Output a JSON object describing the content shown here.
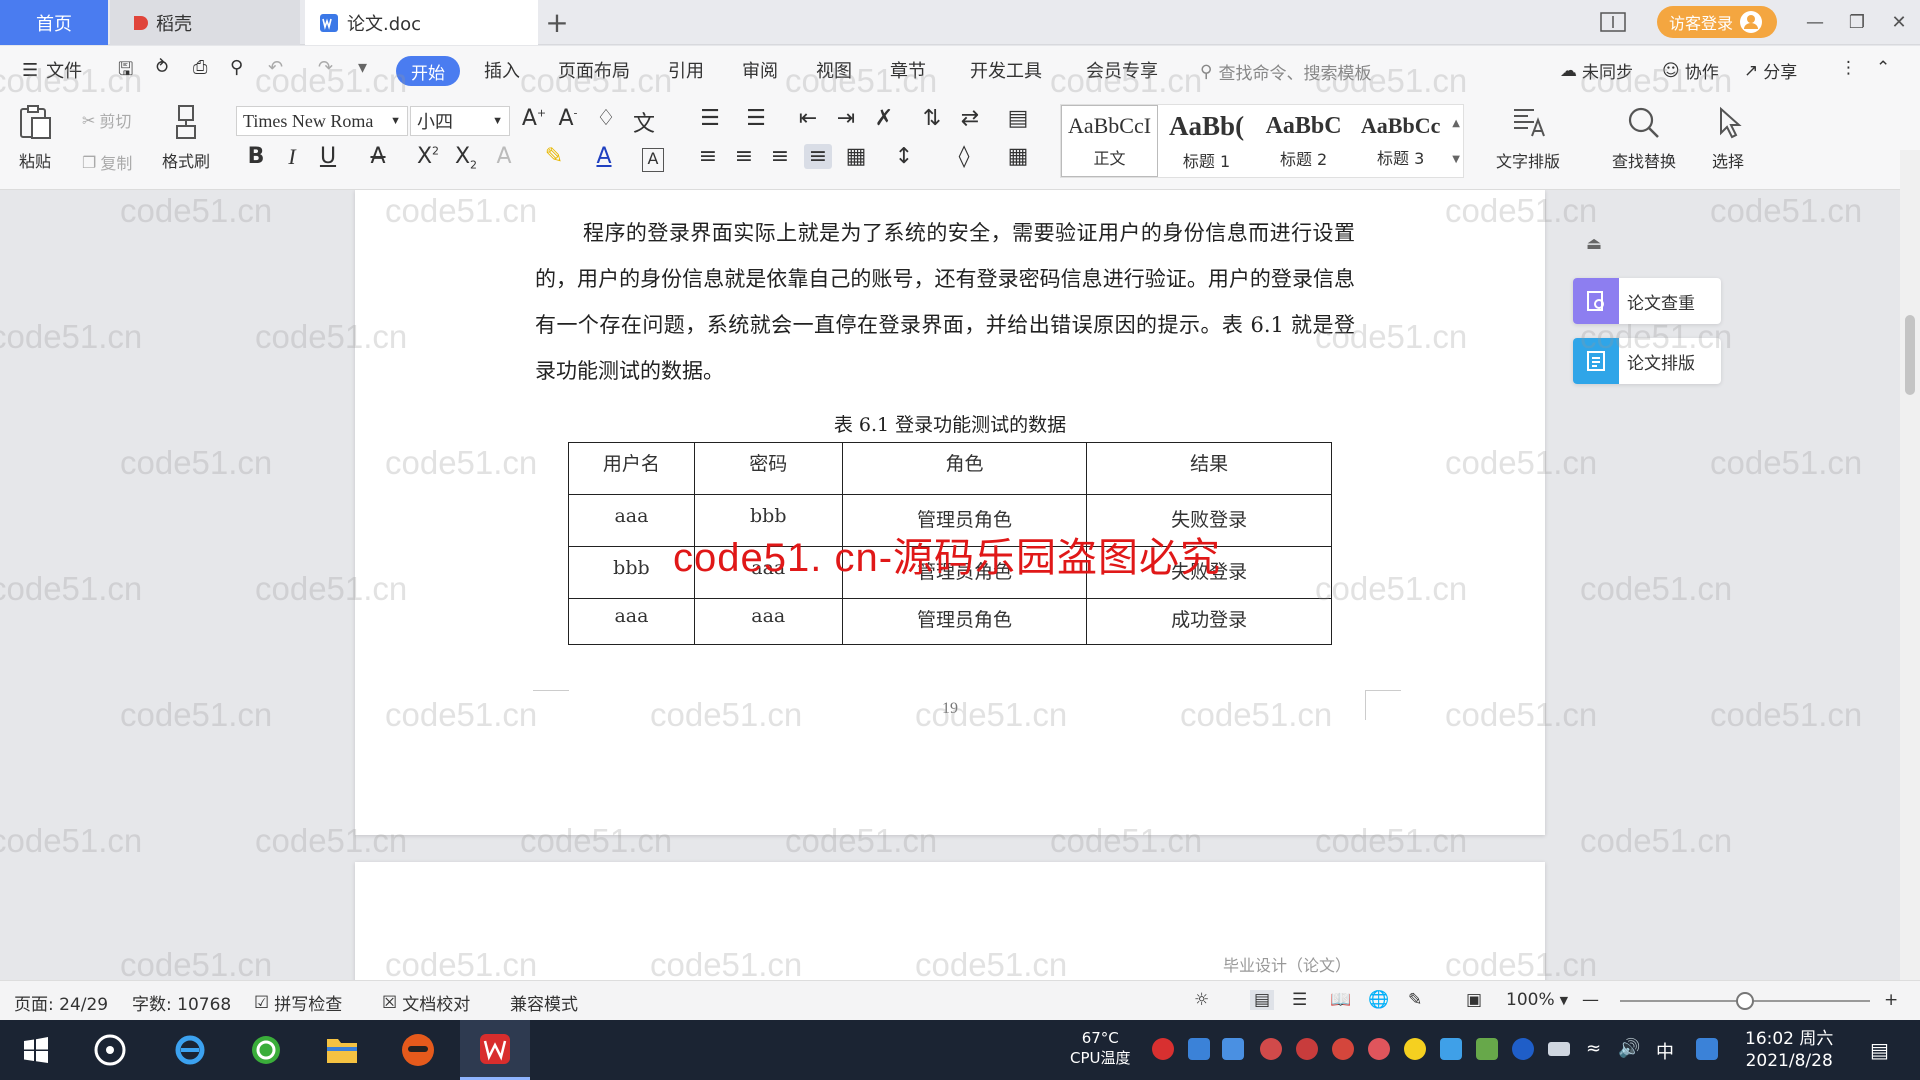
{
  "tabs": {
    "home": "首页",
    "daoke": "稻壳",
    "doc": "论文.doc",
    "add": "+"
  },
  "login": "访客登录",
  "menu": {
    "file": "文件",
    "items": [
      "开始",
      "插入",
      "页面布局",
      "引用",
      "审阅",
      "视图",
      "章节",
      "开发工具",
      "会员专享"
    ],
    "search": "查找命令、搜索模板",
    "sync": "未同步",
    "collab": "协作",
    "share": "分享"
  },
  "ribbon": {
    "paste": "粘贴",
    "cut": "剪切",
    "copy": "复制",
    "format_painter": "格式刷",
    "font": "Times New Roma",
    "size": "小四",
    "styles": [
      {
        "sample": "AaBbCcI",
        "name": "正文"
      },
      {
        "sample": "AaBb(",
        "name": "标题 1"
      },
      {
        "sample": "AaBbC",
        "name": "标题 2"
      },
      {
        "sample": "AaBbCc",
        "name": "标题 3"
      }
    ],
    "text_layout": "文字排版",
    "find_replace": "查找替换",
    "select": "选择"
  },
  "document": {
    "paragraph": "程序的登录界面实际上就是为了系统的安全，需要验证用户的身份信息而进行设置的，用户的身份信息就是依靠自己的账号，还有登录密码信息进行验证。用户的登录信息有一个存在问题，系统就会一直停在登录界面，并给出错误原因的提示。表 6.1  就是登录功能测试的数据。",
    "caption": "表 6.1  登录功能测试的数据",
    "table": {
      "headers": [
        "用户名",
        "密码",
        "角色",
        "结果"
      ],
      "rows": [
        [
          "aaa",
          "bbb",
          "管理员角色",
          "失败登录"
        ],
        [
          "bbb",
          "aaa",
          "管理员角色",
          "失败登录"
        ],
        [
          "aaa",
          "aaa",
          "管理员角色",
          "成功登录"
        ]
      ]
    },
    "overlay": "code51. cn-源码乐园盗图必究",
    "page_number": "19",
    "footer": "毕业设计（论文）"
  },
  "side_panel": {
    "check": "论文查重",
    "layout": "论文排版"
  },
  "status": {
    "page": "页面: 24/29",
    "words": "字数: 10768",
    "spell": "拼写检查",
    "proof": "文档校对",
    "compat": "兼容模式",
    "zoom": "100%",
    "zoom_level": 0.5
  },
  "taskbar": {
    "temp": "67°C",
    "cpu": "CPU温度",
    "time": "16:02 周六",
    "date": "2021/8/28",
    "ime": "中"
  },
  "watermark_text": "code51.cn",
  "colors": {
    "accent": "#4a7cf0",
    "login": "#f4a640",
    "overlay": "#e01818",
    "taskbar": "#1b2433"
  }
}
